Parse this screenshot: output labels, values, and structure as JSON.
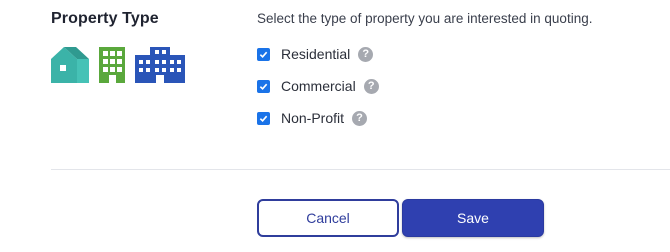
{
  "section": {
    "title": "Property Type",
    "icons": [
      "house-icon",
      "office-building-icon",
      "campus-building-icon"
    ]
  },
  "form": {
    "instructions": "Select the type of property you are interested in quoting.",
    "options": [
      {
        "label": "Residential",
        "checked": true,
        "help_icon": "question-mark-icon"
      },
      {
        "label": "Commercial",
        "checked": true,
        "help_icon": "question-mark-icon"
      },
      {
        "label": "Non-Profit",
        "checked": true,
        "help_icon": "question-mark-icon"
      }
    ]
  },
  "buttons": {
    "cancel_label": "Cancel",
    "save_label": "Save"
  },
  "colors": {
    "house": "#3bb3a8",
    "office": "#5aa83c",
    "campus": "#2a55b8",
    "checkbox": "#1a73e8",
    "primary": "#2f40b0"
  }
}
